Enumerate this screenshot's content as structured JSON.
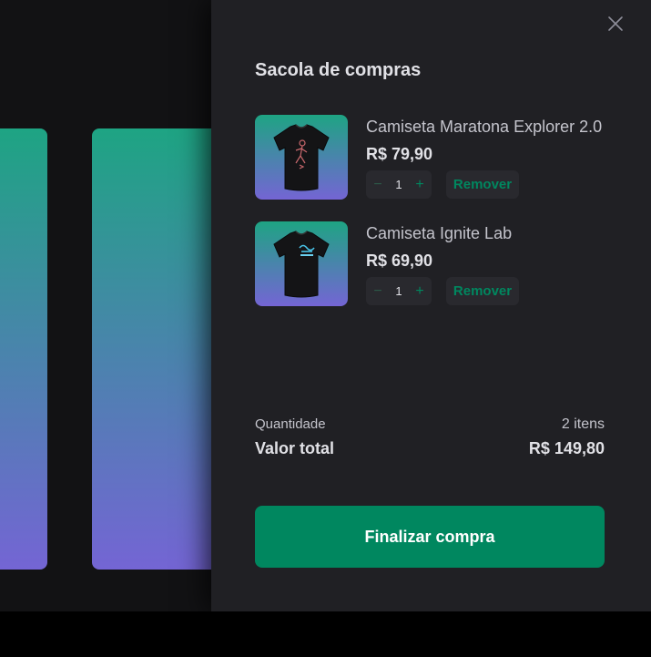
{
  "colors": {
    "accent": "#00875f",
    "drawer_bg": "#202024",
    "page_bg": "#121214",
    "gradient_top": "#1ea483",
    "gradient_bottom": "#7465d4"
  },
  "drawer": {
    "title": "Sacola de compras",
    "close_icon": "close-icon"
  },
  "items": [
    {
      "name": "Camiseta Maratona Explorer 2.0",
      "price": "R$ 79,90",
      "quantity": "1",
      "minus": "−",
      "plus": "+",
      "remove_label": "Remover",
      "image_icon": "tshirt-icon"
    },
    {
      "name": "Camiseta Ignite Lab",
      "price": "R$ 69,90",
      "quantity": "1",
      "minus": "−",
      "plus": "+",
      "remove_label": "Remover",
      "image_icon": "tshirt-icon"
    }
  ],
  "summary": {
    "quantity_label": "Quantidade",
    "quantity_value": "2 itens",
    "total_label": "Valor total",
    "total_value": "R$ 149,80"
  },
  "checkout": {
    "label": "Finalizar compra"
  }
}
